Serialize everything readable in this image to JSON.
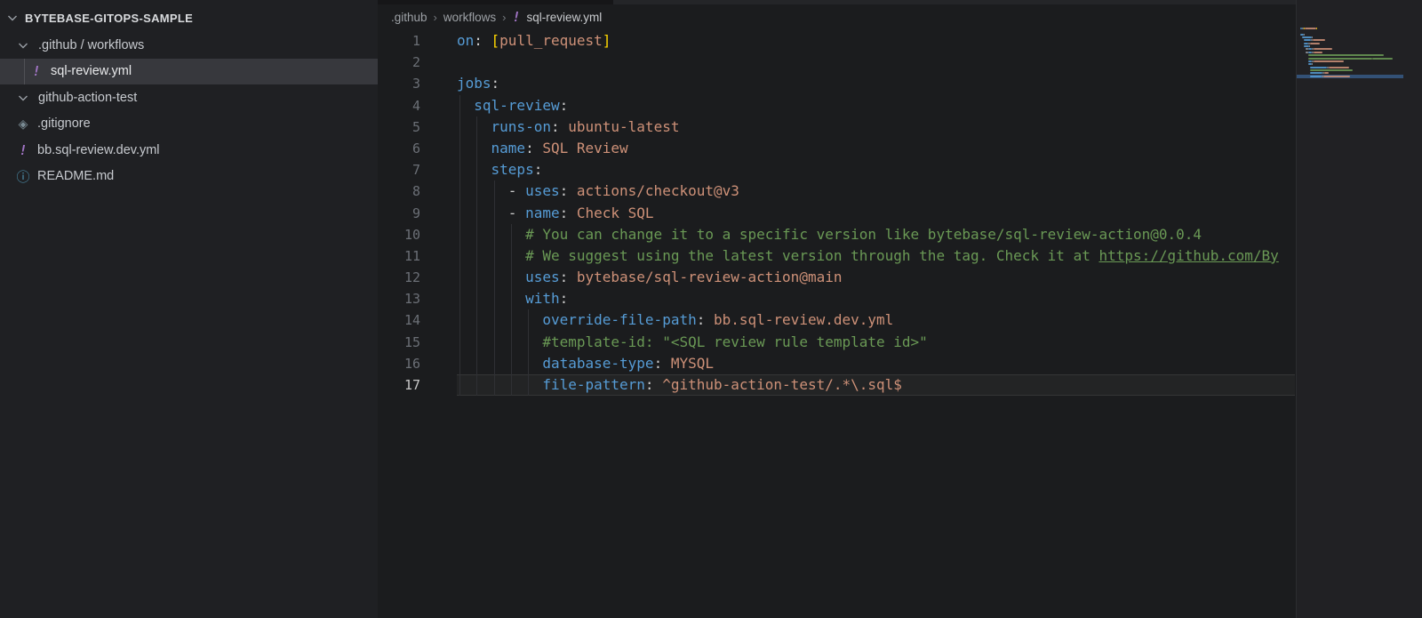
{
  "sidebar": {
    "title": "BYTEBASE-GITOPS-SAMPLE",
    "items": [
      {
        "label": ".github / workflows",
        "icon": "chevron",
        "indent": 0,
        "selected": false
      },
      {
        "label": "sql-review.yml",
        "icon": "yaml",
        "indent": 1,
        "selected": true
      },
      {
        "label": "github-action-test",
        "icon": "chevron",
        "indent": 0,
        "selected": false
      },
      {
        "label": ".gitignore",
        "icon": "git",
        "indent": 0,
        "selected": false
      },
      {
        "label": "bb.sql-review.dev.yml",
        "icon": "yaml",
        "indent": 0,
        "selected": false
      },
      {
        "label": "README.md",
        "icon": "info",
        "indent": 0,
        "selected": false
      }
    ]
  },
  "breadcrumb": {
    "separator": "›",
    "segments": [
      {
        "label": ".github",
        "icon": null
      },
      {
        "label": "workflows",
        "icon": null
      },
      {
        "label": "sql-review.yml",
        "icon": "yaml"
      }
    ]
  },
  "editor": {
    "language": "yaml",
    "lines": [
      {
        "n": 1,
        "indent": 0,
        "tokens": [
          {
            "t": "on",
            "c": "key"
          },
          {
            "t": ": ",
            "c": "punct"
          },
          {
            "t": "[",
            "c": "bracket"
          },
          {
            "t": "pull_request",
            "c": "val"
          },
          {
            "t": "]",
            "c": "bracket"
          }
        ]
      },
      {
        "n": 2,
        "indent": 0,
        "tokens": []
      },
      {
        "n": 3,
        "indent": 0,
        "tokens": [
          {
            "t": "jobs",
            "c": "key"
          },
          {
            "t": ":",
            "c": "punct"
          }
        ]
      },
      {
        "n": 4,
        "indent": 2,
        "tokens": [
          {
            "t": "sql-review",
            "c": "key"
          },
          {
            "t": ":",
            "c": "punct"
          }
        ]
      },
      {
        "n": 5,
        "indent": 4,
        "tokens": [
          {
            "t": "runs-on",
            "c": "key"
          },
          {
            "t": ": ",
            "c": "punct"
          },
          {
            "t": "ubuntu-latest",
            "c": "val"
          }
        ]
      },
      {
        "n": 6,
        "indent": 4,
        "tokens": [
          {
            "t": "name",
            "c": "key"
          },
          {
            "t": ": ",
            "c": "punct"
          },
          {
            "t": "SQL Review",
            "c": "val"
          }
        ]
      },
      {
        "n": 7,
        "indent": 4,
        "tokens": [
          {
            "t": "steps",
            "c": "key"
          },
          {
            "t": ":",
            "c": "punct"
          }
        ]
      },
      {
        "n": 8,
        "indent": 6,
        "tokens": [
          {
            "t": "- ",
            "c": "punct"
          },
          {
            "t": "uses",
            "c": "key"
          },
          {
            "t": ": ",
            "c": "punct"
          },
          {
            "t": "actions/checkout@v3",
            "c": "val"
          }
        ]
      },
      {
        "n": 9,
        "indent": 6,
        "tokens": [
          {
            "t": "- ",
            "c": "punct"
          },
          {
            "t": "name",
            "c": "key"
          },
          {
            "t": ": ",
            "c": "punct"
          },
          {
            "t": "Check SQL",
            "c": "val"
          }
        ]
      },
      {
        "n": 10,
        "indent": 8,
        "tokens": [
          {
            "t": "# You can change it to a specific version like bytebase/sql-review-action@0.0.4",
            "c": "comment"
          }
        ]
      },
      {
        "n": 11,
        "indent": 8,
        "tokens": [
          {
            "t": "# We suggest using the latest version through the tag. Check it at ",
            "c": "comment"
          },
          {
            "t": "https://github.com/By",
            "c": "link"
          }
        ]
      },
      {
        "n": 12,
        "indent": 8,
        "tokens": [
          {
            "t": "uses",
            "c": "key"
          },
          {
            "t": ": ",
            "c": "punct"
          },
          {
            "t": "bytebase/sql-review-action@main",
            "c": "val"
          }
        ]
      },
      {
        "n": 13,
        "indent": 8,
        "tokens": [
          {
            "t": "with",
            "c": "key"
          },
          {
            "t": ":",
            "c": "punct"
          }
        ]
      },
      {
        "n": 14,
        "indent": 10,
        "tokens": [
          {
            "t": "override-file-path",
            "c": "key"
          },
          {
            "t": ": ",
            "c": "punct"
          },
          {
            "t": "bb.sql-review.dev.yml",
            "c": "val"
          }
        ]
      },
      {
        "n": 15,
        "indent": 10,
        "tokens": [
          {
            "t": "#template-id: \"<SQL review rule template id>\"",
            "c": "comment"
          }
        ]
      },
      {
        "n": 16,
        "indent": 10,
        "tokens": [
          {
            "t": "database-type",
            "c": "key"
          },
          {
            "t": ": ",
            "c": "punct"
          },
          {
            "t": "MYSQL",
            "c": "val"
          }
        ]
      },
      {
        "n": 17,
        "indent": 10,
        "current": true,
        "tokens": [
          {
            "t": "file-pattern",
            "c": "key"
          },
          {
            "t": ": ",
            "c": "punct"
          },
          {
            "t": "^github-action-test/.*\\.sql$",
            "c": "val"
          }
        ]
      }
    ]
  },
  "colors": {
    "key": "#569cd6",
    "val": "#ce9178",
    "comment": "#6a9955",
    "bracket": "#ffd700",
    "punct": "#cccccc",
    "linenum": "#6b6f76",
    "linenum_active": "#c7c7c7",
    "yaml_icon": "#a074c4",
    "git_icon": "#7a8b94",
    "info_icon": "#519aba",
    "minimap_highlight": "rgba(70,130,200,0.5)"
  },
  "icons": {
    "yaml": "!",
    "git": "◈",
    "info": "ⓘ"
  }
}
